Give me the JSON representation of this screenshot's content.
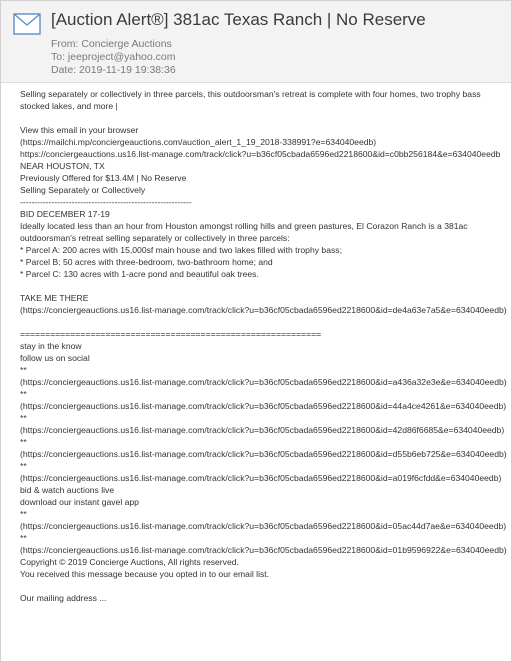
{
  "header": {
    "subject": "[Auction Alert®] 381ac Texas Ranch | No Reserve",
    "from": "From: Concierge Auctions",
    "to": "To: jeeproject@yahoo.com",
    "date": "Date: 2019-11-19 19:38:36",
    "icon": "envelope-icon"
  },
  "body": {
    "intro": "Selling separately or collectively in three parcels, this outdoorsman's retreat is complete with four homes, two trophy bass stocked lakes, and more |",
    "view_browser": "View this email in your browser",
    "view_browser_url": "(https://mailchi.mp/conciergeauctions.com/auction_alert_1_19_2018-338991?e=634040eedb)",
    "track_url_1": "https://conciergeauctions.us16.list-manage.com/track/click?u=b36cf05cbada6596ed2218600&id=c0bb256184&e=634040eedb",
    "location": "NEAR HOUSTON, TX",
    "previously": "Previously Offered for $13.4M | No Reserve",
    "selling": "Selling Separately or Collectively",
    "divider_1": "------------------------------------------------------------",
    "bid_dates": "BID DECEMBER 17-19",
    "description": "Ideally located less than an hour from Houston amongst rolling hills and green pastures, El Corazon Ranch is a 381ac outdoorsman's retreat selling separately or collectively in three parcels:",
    "parcel_a": "* Parcel A: 200 acres with 15,000sf main house and two lakes filled with trophy bass;",
    "parcel_b": "* Parcel B: 50 acres with three-bedroom, two-bathroom home; and",
    "parcel_c": "* Parcel C: 130 acres with 1-acre pond and beautiful oak trees.",
    "take_me_there": "TAKE ME THERE",
    "take_me_there_url": "(https://conciergeauctions.us16.list-manage.com/track/click?u=b36cf05cbada6596ed2218600&id=de4a63e7a5&e=634040eedb)",
    "divider_2": "============================================================",
    "stay_in_know": "stay in the know",
    "follow_social": "follow us on social",
    "stars": "**",
    "social_urls": [
      "(https://conciergeauctions.us16.list-manage.com/track/click?u=b36cf05cbada6596ed2218600&id=a436a32e3e&e=634040eedb)",
      "(https://conciergeauctions.us16.list-manage.com/track/click?u=b36cf05cbada6596ed2218600&id=44a4ce4261&e=634040eedb)",
      "(https://conciergeauctions.us16.list-manage.com/track/click?u=b36cf05cbada6596ed2218600&id=42d86f6685&e=634040eedb)",
      "(https://conciergeauctions.us16.list-manage.com/track/click?u=b36cf05cbada6596ed2218600&id=d55b6eb725&e=634040eedb)",
      "(https://conciergeauctions.us16.list-manage.com/track/click?u=b36cf05cbada6596ed2218600&id=a019f6cfdd&e=634040eedb)"
    ],
    "bid_watch": "bid & watch auctions live",
    "download_app": "download our instant gavel app",
    "app_urls": [
      "(https://conciergeauctions.us16.list-manage.com/track/click?u=b36cf05cbada6596ed2218600&id=05ac44d7ae&e=634040eedb)",
      "(https://conciergeauctions.us16.list-manage.com/track/click?u=b36cf05cbada6596ed2218600&id=01b9596922&e=634040eedb)"
    ],
    "copyright": "Copyright © 2019 Concierge Auctions, All rights reserved.",
    "received": "You received this message because you opted in to our email list.",
    "mailing_address": "Our mailing address ..."
  },
  "colors": {
    "header_bg": "#f3f3f3",
    "icon_stroke": "#5b8fc7",
    "subject_text": "#3a3a3a",
    "meta_text": "#7a7a7a",
    "body_text": "#333333"
  }
}
